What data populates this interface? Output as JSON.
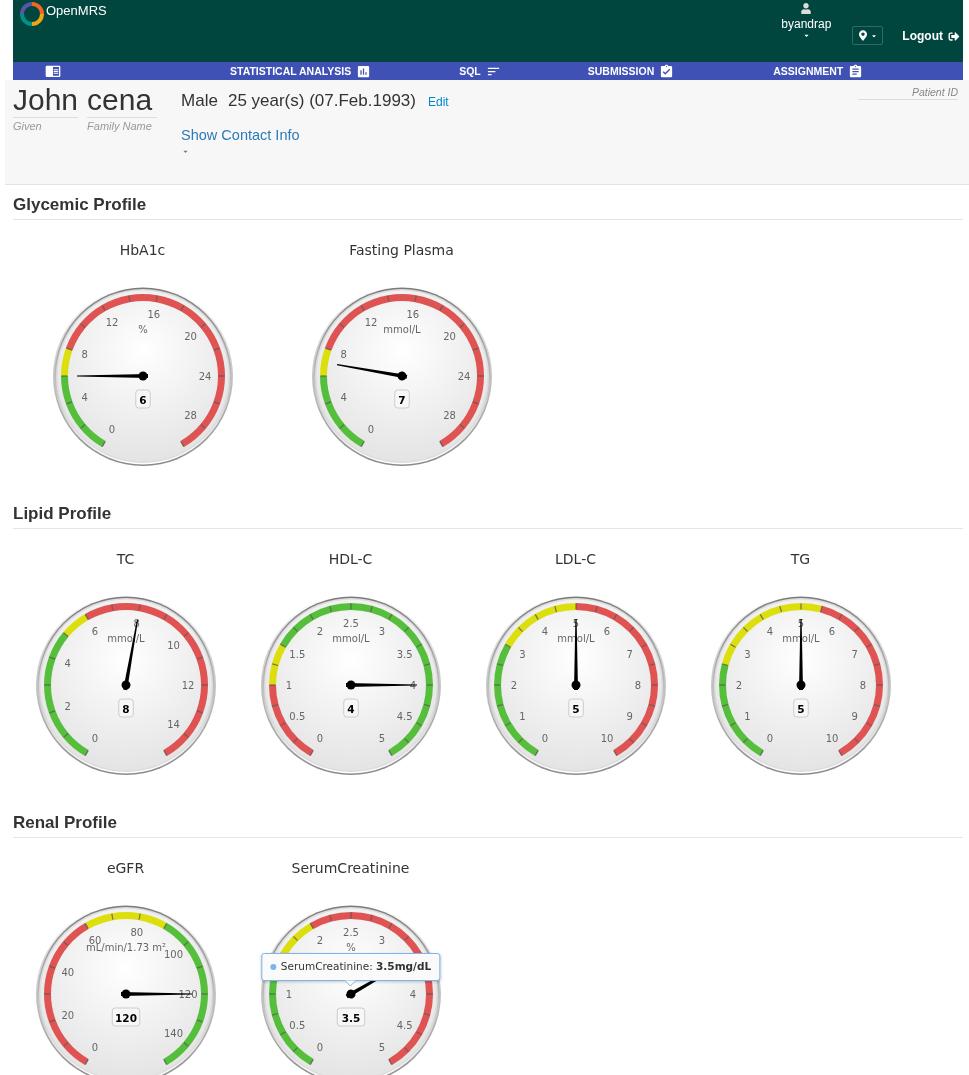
{
  "header": {
    "logo": "OpenMRS",
    "user": "byandrap",
    "logout": "Logout"
  },
  "nav": {
    "items": [
      "STATISTICAL ANALYSIS",
      "SQL",
      "SUBMISSION",
      "ASSIGNMENT"
    ]
  },
  "patient": {
    "given_name": "John",
    "family_name": "cena",
    "given_label": "Given",
    "family_label": "Family Name",
    "gender": "Male",
    "age": "25 year(s) (07.Feb.1993)",
    "edit": "Edit",
    "contact_toggle": "Show Contact Info",
    "id_label": "Patient ID"
  },
  "sections": [
    {
      "title": "Glycemic Profile",
      "gauges": [
        {
          "title": "HbA1c",
          "unit": "%",
          "level": 0.2,
          "reading": "6",
          "ticks": [
            {
              "label": "0"
            },
            {
              "label": "4"
            },
            {
              "label": "8"
            },
            {
              "label": "12"
            },
            {
              "label": "16"
            },
            {
              "label": "20"
            },
            {
              "label": "24"
            },
            {
              "label": "28"
            }
          ],
          "segments": [
            {
              "color": "#55bf3b"
            },
            {
              "color": "#55bf3b"
            },
            {
              "color": "#55bf3b"
            },
            {
              "color": "#dddf0d"
            },
            {
              "color": "#df5353"
            },
            {
              "color": "#df5353"
            },
            {
              "color": "#df5353"
            },
            {
              "color": "#df5353"
            },
            {
              "color": "#df5353"
            },
            {
              "color": "#df5353"
            },
            {
              "color": "#df5353"
            },
            {
              "color": "#df5353"
            },
            {
              "color": "#df5353"
            },
            {
              "color": "#df5353"
            },
            {
              "color": "#df5353"
            }
          ]
        },
        {
          "title": "Fasting Plasma",
          "unit": "mmol/L",
          "level": 0.2333,
          "reading": "7",
          "ticks": [
            {
              "label": "0"
            },
            {
              "label": "4"
            },
            {
              "label": "8"
            },
            {
              "label": "12"
            },
            {
              "label": "16"
            },
            {
              "label": "20"
            },
            {
              "label": "24"
            },
            {
              "label": "28"
            }
          ],
          "segments": [
            {
              "color": "#55bf3b"
            },
            {
              "color": "#55bf3b"
            },
            {
              "color": "#55bf3b"
            },
            {
              "color": "#dddf0d"
            },
            {
              "color": "#df5353"
            },
            {
              "color": "#df5353"
            },
            {
              "color": "#df5353"
            },
            {
              "color": "#df5353"
            },
            {
              "color": "#df5353"
            },
            {
              "color": "#df5353"
            },
            {
              "color": "#df5353"
            },
            {
              "color": "#df5353"
            },
            {
              "color": "#df5353"
            },
            {
              "color": "#df5353"
            },
            {
              "color": "#df5353"
            }
          ]
        }
      ]
    },
    {
      "title": "Lipid Profile",
      "gauges": [
        {
          "title": "TC",
          "unit": "mmol/L",
          "level": 0.5333,
          "reading": "8",
          "ticks": [
            {
              "label": "0"
            },
            {
              "label": "2"
            },
            {
              "label": "4"
            },
            {
              "label": "6"
            },
            {
              "label": "8"
            },
            {
              "label": "10"
            },
            {
              "label": "12"
            },
            {
              "label": "14"
            }
          ],
          "segments": [
            {
              "color": "#55bf3b"
            },
            {
              "color": "#55bf3b"
            },
            {
              "color": "#55bf3b"
            },
            {
              "color": "#55bf3b"
            },
            {
              "color": "#55bf3b"
            },
            {
              "color": "#dddf0d"
            },
            {
              "color": "#df5353"
            },
            {
              "color": "#df5353"
            },
            {
              "color": "#df5353"
            },
            {
              "color": "#df5353"
            },
            {
              "color": "#df5353"
            },
            {
              "color": "#df5353"
            },
            {
              "color": "#df5353"
            },
            {
              "color": "#df5353"
            },
            {
              "color": "#df5353"
            }
          ]
        },
        {
          "title": "HDL-C",
          "unit": "mmol/L",
          "level": 0.8,
          "reading": "4",
          "ticks": [
            {
              "label": "0"
            },
            {
              "label": "0.5"
            },
            {
              "label": "1"
            },
            {
              "label": "1.5"
            },
            {
              "label": "2"
            },
            {
              "label": "2.5"
            },
            {
              "label": "3"
            },
            {
              "label": "3.5"
            },
            {
              "label": "4"
            },
            {
              "label": "4.5"
            },
            {
              "label": "5"
            }
          ],
          "segments": [
            {
              "color": "#df5353"
            },
            {
              "color": "#df5353"
            },
            {
              "color": "#df5353"
            },
            {
              "color": "#df5353"
            },
            {
              "color": "#dddf0d"
            },
            {
              "color": "#dddf0d"
            },
            {
              "color": "#55bf3b"
            },
            {
              "color": "#55bf3b"
            },
            {
              "color": "#55bf3b"
            },
            {
              "color": "#55bf3b"
            },
            {
              "color": "#55bf3b"
            },
            {
              "color": "#55bf3b"
            },
            {
              "color": "#55bf3b"
            },
            {
              "color": "#55bf3b"
            },
            {
              "color": "#55bf3b"
            },
            {
              "color": "#55bf3b"
            },
            {
              "color": "#55bf3b"
            },
            {
              "color": "#55bf3b"
            },
            {
              "color": "#55bf3b"
            },
            {
              "color": "#55bf3b"
            }
          ]
        },
        {
          "title": "LDL-C",
          "unit": "mmol/L",
          "level": 0.5,
          "reading": "5",
          "ticks": [
            {
              "label": "0"
            },
            {
              "label": "1"
            },
            {
              "label": "2"
            },
            {
              "label": "3"
            },
            {
              "label": "4"
            },
            {
              "label": "5"
            },
            {
              "label": "6"
            },
            {
              "label": "7"
            },
            {
              "label": "8"
            },
            {
              "label": "9"
            },
            {
              "label": "10"
            }
          ],
          "segments": [
            {
              "color": "#55bf3b"
            },
            {
              "color": "#55bf3b"
            },
            {
              "color": "#55bf3b"
            },
            {
              "color": "#55bf3b"
            },
            {
              "color": "#55bf3b"
            },
            {
              "color": "#55bf3b"
            },
            {
              "color": "#dddf0d"
            },
            {
              "color": "#dddf0d"
            },
            {
              "color": "#dddf0d"
            },
            {
              "color": "#dddf0d"
            },
            {
              "color": "#df5353"
            },
            {
              "color": "#df5353"
            },
            {
              "color": "#df5353"
            },
            {
              "color": "#df5353"
            },
            {
              "color": "#df5353"
            },
            {
              "color": "#df5353"
            },
            {
              "color": "#df5353"
            },
            {
              "color": "#df5353"
            },
            {
              "color": "#df5353"
            },
            {
              "color": "#df5353"
            }
          ]
        },
        {
          "title": "TG",
          "unit": "mmol/L",
          "level": 0.5,
          "reading": "5",
          "ticks": [
            {
              "label": "0"
            },
            {
              "label": "1"
            },
            {
              "label": "2"
            },
            {
              "label": "3"
            },
            {
              "label": "4"
            },
            {
              "label": "5"
            },
            {
              "label": "6"
            },
            {
              "label": "7"
            },
            {
              "label": "8"
            },
            {
              "label": "9"
            },
            {
              "label": "10"
            }
          ],
          "segments": [
            {
              "color": "#55bf3b"
            },
            {
              "color": "#55bf3b"
            },
            {
              "color": "#55bf3b"
            },
            {
              "color": "#55bf3b"
            },
            {
              "color": "#55bf3b"
            },
            {
              "color": "#dddf0d"
            },
            {
              "color": "#dddf0d"
            },
            {
              "color": "#dddf0d"
            },
            {
              "color": "#dddf0d"
            },
            {
              "color": "#dddf0d"
            },
            {
              "color": "#dddf0d"
            },
            {
              "color": "#df5353"
            },
            {
              "color": "#df5353"
            },
            {
              "color": "#df5353"
            },
            {
              "color": "#df5353"
            },
            {
              "color": "#df5353"
            },
            {
              "color": "#df5353"
            },
            {
              "color": "#df5353"
            },
            {
              "color": "#df5353"
            },
            {
              "color": "#df5353"
            }
          ]
        }
      ]
    },
    {
      "title": "Renal Profile",
      "gauges": [
        {
          "title": "eGFR",
          "unit": "mL/min/1.73 m²",
          "level": 0.8,
          "reading": "120",
          "ticks": [
            {
              "label": "0"
            },
            {
              "label": "20"
            },
            {
              "label": "40"
            },
            {
              "label": "60"
            },
            {
              "label": "80"
            },
            {
              "label": "100"
            },
            {
              "label": "120"
            },
            {
              "label": "140"
            }
          ],
          "segments": [
            {
              "color": "#df5353"
            },
            {
              "color": "#df5353"
            },
            {
              "color": "#df5353"
            },
            {
              "color": "#df5353"
            },
            {
              "color": "#df5353"
            },
            {
              "color": "#df5353"
            },
            {
              "color": "#dddf0d"
            },
            {
              "color": "#dddf0d"
            },
            {
              "color": "#dddf0d"
            },
            {
              "color": "#55bf3b"
            },
            {
              "color": "#55bf3b"
            },
            {
              "color": "#55bf3b"
            },
            {
              "color": "#55bf3b"
            },
            {
              "color": "#55bf3b"
            },
            {
              "color": "#55bf3b"
            }
          ]
        },
        {
          "title": "SerumCreatinine",
          "unit": "%",
          "level": 0.7,
          "reading": "3.5",
          "ticks": [
            {
              "label": "0"
            },
            {
              "label": "0.5"
            },
            {
              "label": "1"
            },
            {
              "label": "2",
              "gap_before": true
            },
            {
              "label": "2.5"
            },
            {
              "label": "3"
            },
            {
              "label": "4",
              "gap_before": true
            },
            {
              "label": "4.5"
            },
            {
              "label": "5"
            }
          ],
          "segments": [
            {
              "color": "#55bf3b"
            },
            {
              "color": "#55bf3b"
            },
            {
              "color": "#55bf3b"
            },
            {
              "color": "#55bf3b"
            },
            {
              "color": "#55bf3b"
            },
            {
              "color": "#dddf0d",
              "gap_before": true
            },
            {
              "color": "#dddf0d"
            },
            {
              "color": "#df5353"
            },
            {
              "color": "#df5353"
            },
            {
              "color": "#df5353"
            },
            {
              "color": "#df5353"
            },
            {
              "color": "#df5353"
            },
            {
              "color": "#df5353"
            },
            {
              "color": "#df5353",
              "gap_before": true
            },
            {
              "color": "#df5353"
            },
            {
              "color": "#df5353"
            },
            {
              "color": "#df5353"
            },
            {
              "color": "#df5353"
            }
          ],
          "tooltip": "SerumCreatinine: **3.5mg/dL**"
        }
      ]
    }
  ]
}
